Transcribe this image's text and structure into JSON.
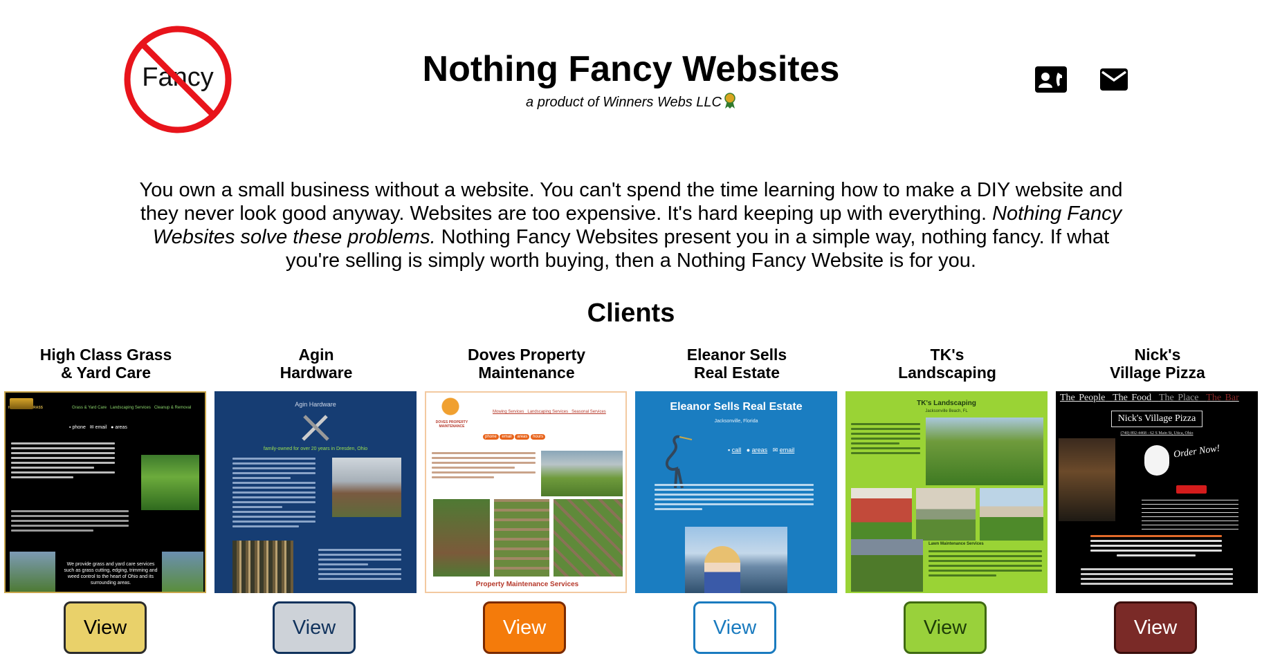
{
  "header": {
    "logo_text": "Fancy",
    "title": "Nothing Fancy Websites",
    "subtitle": "a product of Winners Webs LLC",
    "contact_card_icon": "contact-card-icon",
    "email_icon": "envelope-icon"
  },
  "intro": {
    "part1": "You own a small business without a website. You can't spend the time learning how to make a DIY website and they never look good anyway. Websites are too expensive. It's hard keeping up with everything. ",
    "emphasis": "Nothing Fancy Websites solve these problems.",
    "part2": " Nothing Fancy Websites present you in a simple way, nothing fancy. If what you're selling is simply worth buying, then a Nothing Fancy Website is for you."
  },
  "clients_heading": "Clients",
  "clients": [
    {
      "line1": "High Class Grass",
      "line2": "& Yard Care",
      "button": "View",
      "button_bg": "#e9d16a",
      "button_border": "#2b2b2b",
      "button_color": "#000000",
      "thumb": {
        "bg": "#000000",
        "nav": [
          "Grass & Yard Care",
          "Landscaping Services",
          "Cleanup & Removal"
        ],
        "links": [
          "phone",
          "email",
          "areas"
        ],
        "brand": "HIGH CLASS GRASS",
        "footer": "We provide grass and yard care services such as grass cutting, edging, trimming and weed control to the heart of Ohio and its surrounding areas."
      }
    },
    {
      "line1": "Agin",
      "line2": "Hardware",
      "button": "View",
      "button_bg": "#cdd2d8",
      "button_border": "#10325c",
      "button_color": "#10325c",
      "thumb": {
        "bg": "#163d73",
        "title": "Agin Hardware",
        "tagline": "family-owned for over 20 years in Dresden, Ohio"
      }
    },
    {
      "line1": "Doves Property",
      "line2": "Maintenance",
      "button": "View",
      "button_bg": "#f47b0b",
      "button_border": "#7a2a00",
      "button_color": "#ffffff",
      "thumb": {
        "bg": "#ffffff",
        "nav": [
          "Mowing Services",
          "Landscaping Services",
          "Seasonal Services"
        ],
        "links": [
          "phone",
          "email",
          "areas",
          "hours"
        ],
        "brand": "DOVES PROPERTY MAINTENANCE",
        "footer": "Property Maintenance Services"
      }
    },
    {
      "line1": "Eleanor Sells",
      "line2": "Real Estate",
      "button": "View",
      "button_bg": "#ffffff",
      "button_border": "#1a7bbf",
      "button_color": "#1a7bbf",
      "thumb": {
        "bg": "#1a7dc1",
        "title": "Eleanor Sells Real Estate",
        "location": "Jacksonville, Florida",
        "links": [
          "call",
          "areas",
          "email"
        ]
      }
    },
    {
      "line1": "TK's",
      "line2": "Landscaping",
      "button": "View",
      "button_bg": "#99d13b",
      "button_border": "#3f6a12",
      "button_color": "#1e3d08",
      "thumb": {
        "bg": "#9ad335",
        "title": "TK's Landscaping",
        "location": "Jacksonville Beach, FL",
        "section": "Lawn Maintenance Services"
      }
    },
    {
      "line1": "Nick's",
      "line2": "Village Pizza",
      "button": "View",
      "button_bg": "#7a2a27",
      "button_border": "#3a0e0c",
      "button_color": "#ffffff",
      "thumb": {
        "bg": "#000000",
        "nav": [
          "The People",
          "The Food",
          "The Place",
          "The Bar"
        ],
        "title": "Nick's Village Pizza",
        "phone": "(740) 892-4468 - 62 S Main St, Utica, Ohio",
        "order": "Order Now!"
      }
    }
  ]
}
